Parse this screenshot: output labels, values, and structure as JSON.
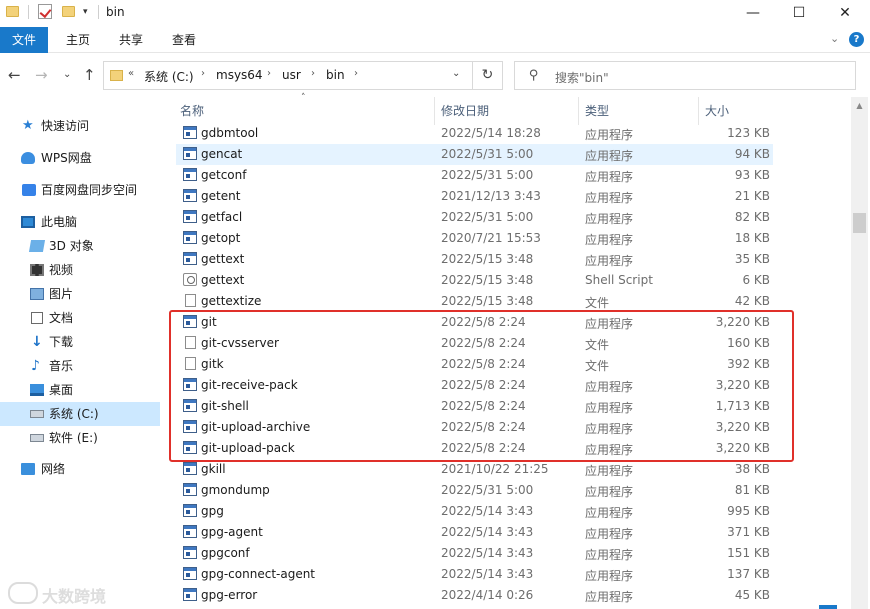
{
  "titlebar": {
    "title": "bin",
    "minimize_glyph": "—",
    "maximize_glyph": "☐",
    "close_glyph": "✕"
  },
  "ribbon": {
    "tabs": [
      "文件",
      "主页",
      "共享",
      "查看"
    ],
    "collapse_glyph": "⌄",
    "help_glyph": "?"
  },
  "nav": {
    "back_glyph": "←",
    "forward_glyph": "→",
    "recent_glyph": "⌄",
    "up_glyph": "↑",
    "overflow": "«",
    "breadcrumbs": [
      "系统 (C:)",
      "msys64",
      "usr",
      "bin"
    ],
    "separator_glyph": "›",
    "dropdown_glyph": "⌄",
    "refresh_glyph": "↻"
  },
  "search": {
    "placeholder": "搜索\"bin\"",
    "icon": "search-icon"
  },
  "sidebar": {
    "items": [
      {
        "label": "快速访问",
        "icon": "star-icon"
      },
      {
        "label": "WPS网盘",
        "icon": "cloud-icon"
      },
      {
        "label": "百度网盘同步空间",
        "icon": "baidu-icon"
      },
      {
        "label": "此电脑",
        "icon": "computer-icon"
      },
      {
        "label": "3D 对象",
        "icon": "3d-objects-icon"
      },
      {
        "label": "视频",
        "icon": "video-icon"
      },
      {
        "label": "图片",
        "icon": "pictures-icon"
      },
      {
        "label": "文档",
        "icon": "documents-icon"
      },
      {
        "label": "下载",
        "icon": "download-icon"
      },
      {
        "label": "音乐",
        "icon": "music-icon"
      },
      {
        "label": "桌面",
        "icon": "desktop-icon"
      },
      {
        "label": "系统 (C:)",
        "icon": "drive-icon",
        "selected": true
      },
      {
        "label": "软件 (E:)",
        "icon": "drive-icon"
      },
      {
        "label": "网络",
        "icon": "network-icon"
      }
    ]
  },
  "columns": {
    "name": "名称",
    "date": "修改日期",
    "type": "类型",
    "size": "大小",
    "sort_glyph": "˄"
  },
  "files": [
    {
      "name": "gdbmtool",
      "date": "2022/5/14 18:28",
      "type": "应用程序",
      "size": "123 KB",
      "kind": "exe"
    },
    {
      "name": "gencat",
      "date": "2022/5/31 5:00",
      "type": "应用程序",
      "size": "94 KB",
      "kind": "exe",
      "highlighted": true
    },
    {
      "name": "getconf",
      "date": "2022/5/31 5:00",
      "type": "应用程序",
      "size": "93 KB",
      "kind": "exe"
    },
    {
      "name": "getent",
      "date": "2021/12/13 3:43",
      "type": "应用程序",
      "size": "21 KB",
      "kind": "exe"
    },
    {
      "name": "getfacl",
      "date": "2022/5/31 5:00",
      "type": "应用程序",
      "size": "82 KB",
      "kind": "exe"
    },
    {
      "name": "getopt",
      "date": "2020/7/21 15:53",
      "type": "应用程序",
      "size": "18 KB",
      "kind": "exe"
    },
    {
      "name": "gettext",
      "date": "2022/5/15 3:48",
      "type": "应用程序",
      "size": "35 KB",
      "kind": "exe"
    },
    {
      "name": "gettext",
      "date": "2022/5/15 3:48",
      "type": "Shell Script",
      "size": "6 KB",
      "kind": "shell"
    },
    {
      "name": "gettextize",
      "date": "2022/5/15 3:48",
      "type": "文件",
      "size": "42 KB",
      "kind": "file"
    },
    {
      "name": "git",
      "date": "2022/5/8 2:24",
      "type": "应用程序",
      "size": "3,220 KB",
      "kind": "exe"
    },
    {
      "name": "git-cvsserver",
      "date": "2022/5/8 2:24",
      "type": "文件",
      "size": "160 KB",
      "kind": "file"
    },
    {
      "name": "gitk",
      "date": "2022/5/8 2:24",
      "type": "文件",
      "size": "392 KB",
      "kind": "file"
    },
    {
      "name": "git-receive-pack",
      "date": "2022/5/8 2:24",
      "type": "应用程序",
      "size": "3,220 KB",
      "kind": "exe"
    },
    {
      "name": "git-shell",
      "date": "2022/5/8 2:24",
      "type": "应用程序",
      "size": "1,713 KB",
      "kind": "exe"
    },
    {
      "name": "git-upload-archive",
      "date": "2022/5/8 2:24",
      "type": "应用程序",
      "size": "3,220 KB",
      "kind": "exe"
    },
    {
      "name": "git-upload-pack",
      "date": "2022/5/8 2:24",
      "type": "应用程序",
      "size": "3,220 KB",
      "kind": "exe"
    },
    {
      "name": "gkill",
      "date": "2021/10/22 21:25",
      "type": "应用程序",
      "size": "38 KB",
      "kind": "exe"
    },
    {
      "name": "gmondump",
      "date": "2022/5/31 5:00",
      "type": "应用程序",
      "size": "81 KB",
      "kind": "exe"
    },
    {
      "name": "gpg",
      "date": "2022/5/14 3:43",
      "type": "应用程序",
      "size": "995 KB",
      "kind": "exe"
    },
    {
      "name": "gpg-agent",
      "date": "2022/5/14 3:43",
      "type": "应用程序",
      "size": "371 KB",
      "kind": "exe"
    },
    {
      "name": "gpgconf",
      "date": "2022/5/14 3:43",
      "type": "应用程序",
      "size": "151 KB",
      "kind": "exe"
    },
    {
      "name": "gpg-connect-agent",
      "date": "2022/5/14 3:43",
      "type": "应用程序",
      "size": "137 KB",
      "kind": "exe"
    },
    {
      "name": "gpg-error",
      "date": "2022/4/14 0:26",
      "type": "应用程序",
      "size": "45 KB",
      "kind": "exe"
    }
  ],
  "scrollbar": {
    "up_glyph": "▲"
  },
  "watermark": {
    "text": "大数跨境"
  },
  "colors": {
    "accent": "#1979ca",
    "selection": "#cce8ff",
    "hover_row": "#e5f3ff",
    "highlight_box": "#e0302a"
  }
}
